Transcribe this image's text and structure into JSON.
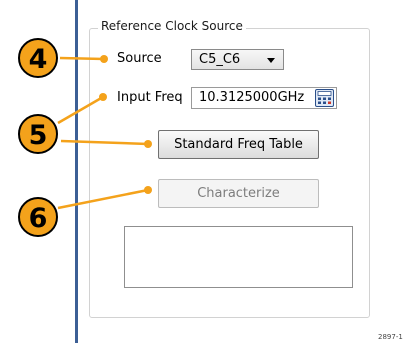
{
  "group": {
    "title": "Reference Clock Source"
  },
  "source": {
    "label": "Source",
    "selected": "C5_C6"
  },
  "input_freq": {
    "label": "Input Freq",
    "value": "10.3125000GHz",
    "icon": "calculator-icon"
  },
  "buttons": {
    "standard_freq_table": "Standard Freq Table",
    "characterize": "Characterize"
  },
  "callouts": [
    "4",
    "5",
    "6"
  ],
  "figure_id": "2897-1",
  "colors": {
    "callout_fill": "#f4a21b",
    "callout_line": "#f4a21b",
    "vertical_rule": "#3c5f95"
  }
}
